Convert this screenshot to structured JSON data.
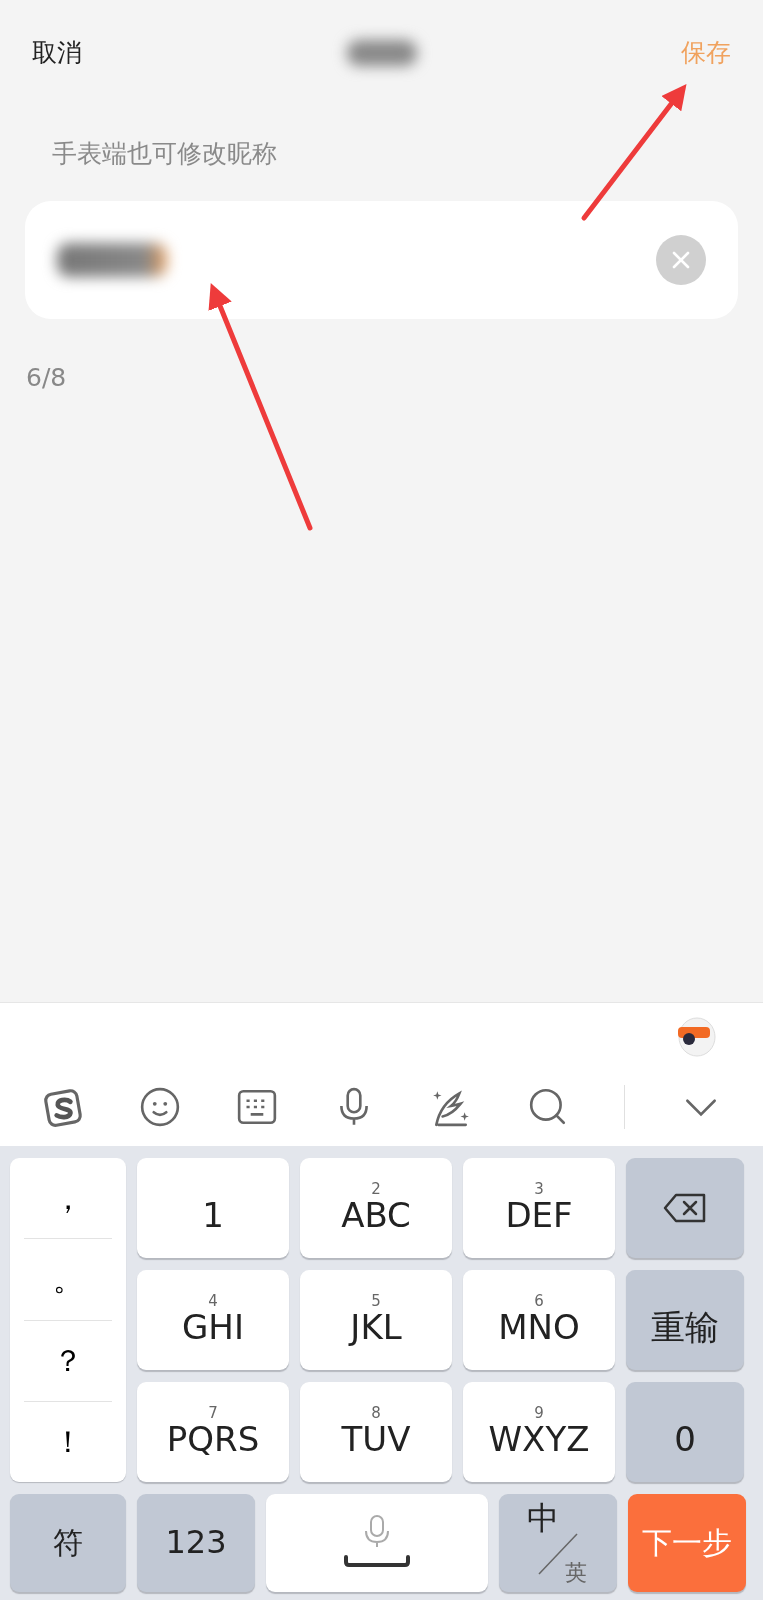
{
  "header": {
    "cancel": "取消",
    "title_blurred": true,
    "save": "保存"
  },
  "hint": "手表端也可修改昵称",
  "name_field": {
    "value_blurred": true,
    "clear": true
  },
  "counter": "6/8",
  "annotation_arrows": [
    {
      "kind": "arrow"
    },
    {
      "kind": "arrow"
    }
  ],
  "keyboard": {
    "toolbar": [
      {
        "kind": "logo"
      },
      {
        "kind": "emoji"
      },
      {
        "kind": "keyboard"
      },
      {
        "kind": "mic"
      },
      {
        "kind": "handwriting"
      },
      {
        "kind": "search"
      },
      {
        "kind": "collapse"
      }
    ],
    "punctuation": [
      "，",
      "。",
      "？",
      "！"
    ],
    "keys": [
      {
        "label": "1",
        "kind": "char"
      },
      {
        "digit": "2",
        "label": "ABC",
        "kind": "char"
      },
      {
        "digit": "3",
        "label": "DEF",
        "kind": "char"
      },
      {
        "kind": "backspace"
      },
      {
        "digit": "4",
        "label": "GHI",
        "kind": "char"
      },
      {
        "digit": "5",
        "label": "JKL",
        "kind": "char"
      },
      {
        "digit": "6",
        "label": "MNO",
        "kind": "char"
      },
      {
        "label": "重输",
        "kind": "func"
      },
      {
        "digit": "7",
        "label": "PQRS",
        "kind": "char"
      },
      {
        "digit": "8",
        "label": "TUV",
        "kind": "char"
      },
      {
        "digit": "9",
        "label": "WXYZ",
        "kind": "char"
      },
      {
        "label": "0",
        "kind": "func"
      }
    ],
    "bottom": [
      {
        "kind": "func",
        "label": "符"
      },
      {
        "kind": "func",
        "label": "123"
      },
      {
        "kind": "space"
      },
      {
        "kind": "lang",
        "label": "中",
        "sub": "英"
      },
      {
        "kind": "enter",
        "label": "下一步"
      }
    ]
  }
}
